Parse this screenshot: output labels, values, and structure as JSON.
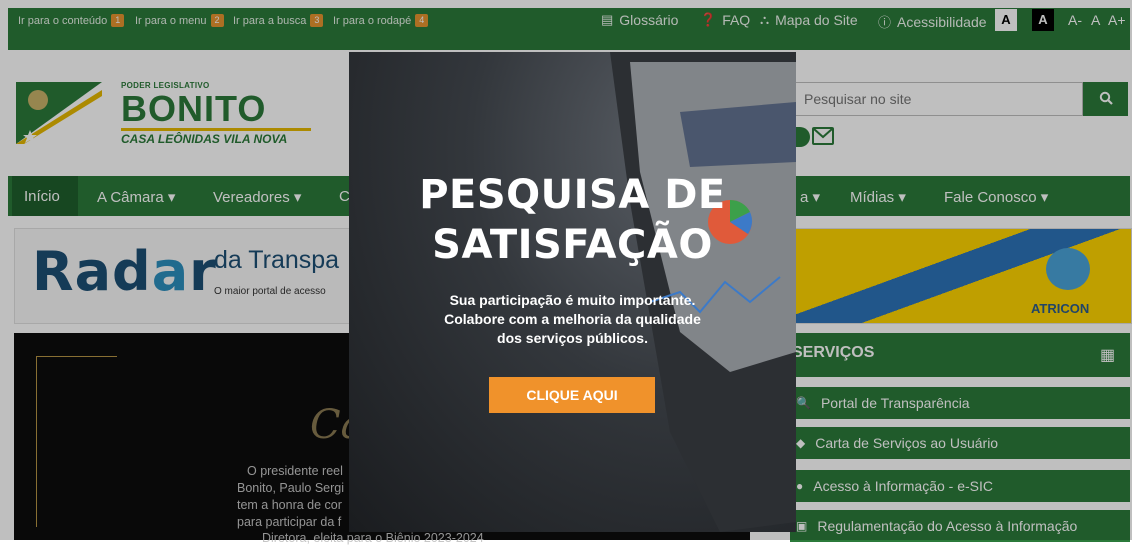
{
  "skip_links": [
    {
      "label": "Ir para o conteúdo",
      "num": "1"
    },
    {
      "label": "Ir para o menu",
      "num": "2"
    },
    {
      "label": "Ir para a busca",
      "num": "3"
    },
    {
      "label": "Ir para o rodapé",
      "num": "4"
    }
  ],
  "top_links": {
    "glossario": "Glossário",
    "faq": "FAQ",
    "mapa": "Mapa do Site",
    "acessibilidade": "Acessibilidade",
    "contrast_a1": "A",
    "contrast_a2": "A",
    "font_minus": "A-",
    "font_normal": "A",
    "font_plus": "A+"
  },
  "logo": {
    "small": "PODER LEGISLATIVO",
    "big": "BONITO",
    "sub": "CASA LEÔNIDAS VILA NOVA"
  },
  "search": {
    "placeholder": "Pesquisar no site"
  },
  "nav": {
    "inicio": "Início",
    "camara": "A Câmara ▾",
    "vereadores": "Vereadores ▾",
    "c": "C",
    "a": "a ▾",
    "midias": "Mídias ▾",
    "fale": "Fale Conosco ▾"
  },
  "radar": {
    "word_r": "Rad",
    "word_a": "a",
    "word_r2": "r",
    "sub1": "da Transpa",
    "sub2": "O maior portal de acesso"
  },
  "atricon": {
    "label": "ATRICON"
  },
  "slide": {
    "script": "Ca",
    "lines": [
      "O presidente reel",
      "Bonito, Paulo Sergi",
      "tem a honra de cor",
      "para participar da f",
      "Diretora, eleita para o Biênio 2023-2024"
    ]
  },
  "servicos": {
    "title": "SERVIÇOS",
    "items": [
      "Portal de Transparência",
      "Carta de Serviços ao Usuário",
      "Acesso à Informação - e-SIC",
      "Regulamentação do Acesso à Informação"
    ]
  },
  "modal": {
    "title_line1": "PESQUISA DE",
    "title_line2": "SATISFAÇÃO",
    "desc_line1": "Sua participação é muito importante.",
    "desc_line2": "Colabore com a melhoria da qualidade",
    "desc_line3": "dos serviços públicos.",
    "cta": "CLIQUE AQUI"
  },
  "colors": {
    "brand_green": "#2b7a3a",
    "accent_orange": "#f0922b"
  }
}
